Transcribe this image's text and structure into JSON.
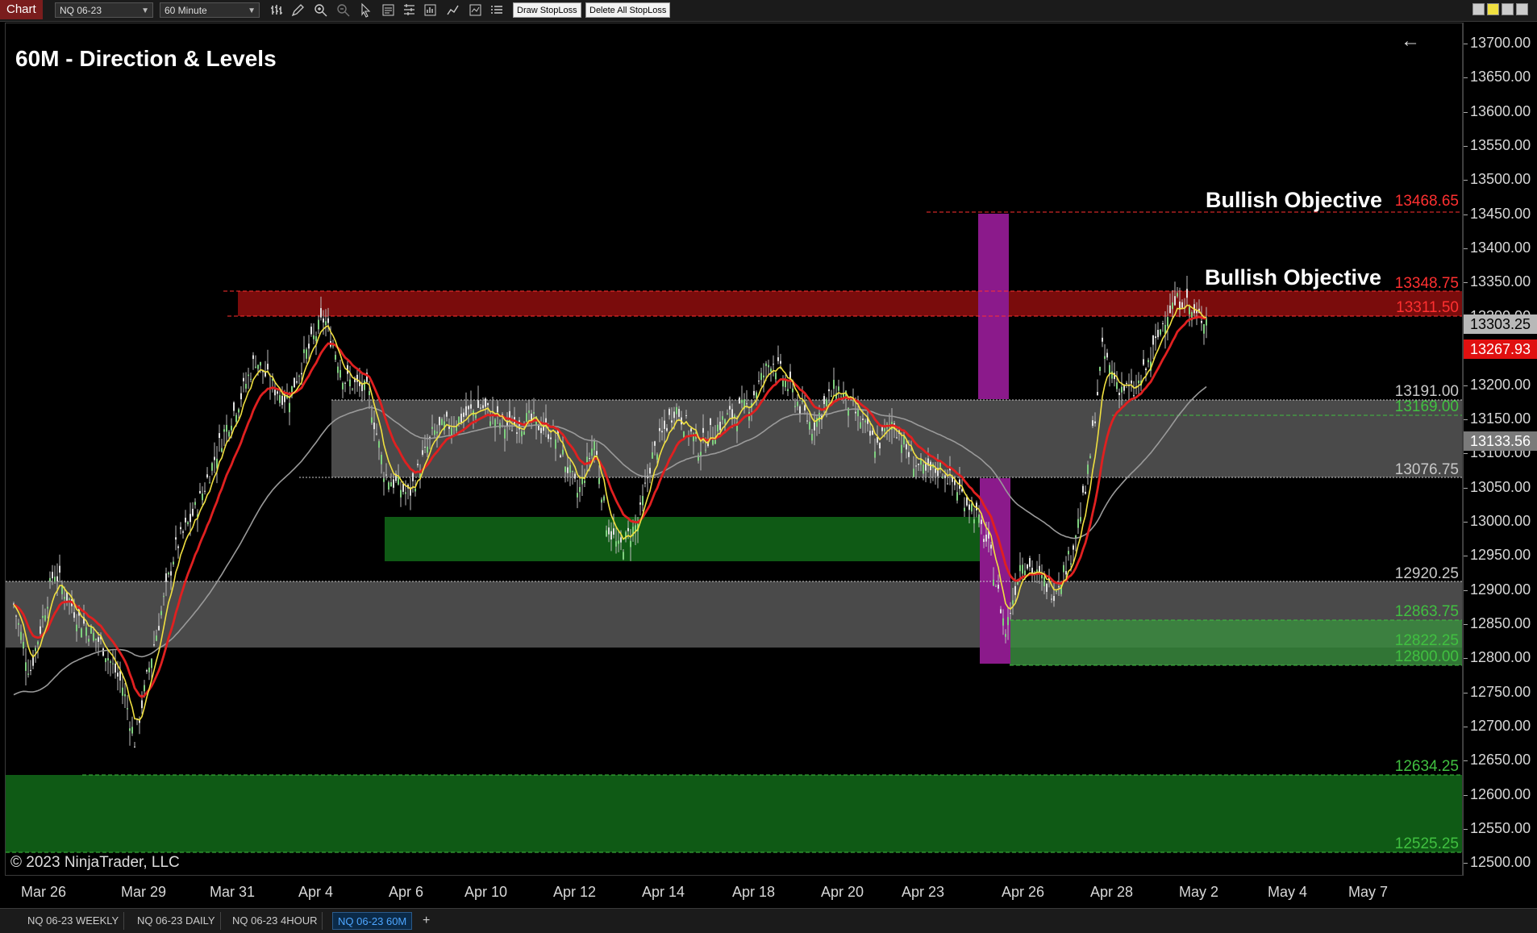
{
  "toolbar": {
    "app_label": "Chart",
    "instrument": "NQ 06-23",
    "interval": "60 Minute",
    "draw_stoploss": "Draw StopLoss",
    "delete_stoploss": "Delete All StopLoss"
  },
  "chart": {
    "title": "60M - Direction & Levels",
    "copyright": "© 2023 NinjaTrader, LLC",
    "objective_label_upper": "Bullish Objective",
    "objective_label_lower": "Bullish Objective"
  },
  "levels": {
    "l13468": "13468.65",
    "l13348": "13348.75",
    "l13311": "13311.50",
    "l13191": "13191.00",
    "l13169": "13169.00",
    "l13076": "13076.75",
    "l12920": "12920.25",
    "l12863": "12863.75",
    "l12822": "12822.25",
    "l12800": "12800.00",
    "l12634": "12634.25",
    "l12525": "12525.25"
  },
  "price_tags": {
    "last": "13303.25",
    "red_ma": "13267.93",
    "gray_ma": "13133.56"
  },
  "price_axis": [
    "13700.00",
    "13650.00",
    "13600.00",
    "13550.00",
    "13500.00",
    "13450.00",
    "13400.00",
    "13350.00",
    "13300.00",
    "13250.00",
    "13200.00",
    "13150.00",
    "13100.00",
    "13050.00",
    "13000.00",
    "12950.00",
    "12900.00",
    "12850.00",
    "12800.00",
    "12750.00",
    "12700.00",
    "12650.00",
    "12600.00",
    "12550.00",
    "12500.00"
  ],
  "date_axis": [
    "Mar 26",
    "Mar 29",
    "Mar 31",
    "Apr 4",
    "Apr 6",
    "Apr 10",
    "Apr 12",
    "Apr 14",
    "Apr 18",
    "Apr 20",
    "Apr 23",
    "Apr 26",
    "Apr 28",
    "May 2",
    "May 4",
    "May 7"
  ],
  "bottom_tabs": [
    "NQ 06-23 WEEKLY",
    "NQ 06-23 DAILY",
    "NQ 06-23 4HOUR",
    "NQ 06-23 60M"
  ],
  "colors": {
    "background": "#000000",
    "supply_zone": "#7a0c0c",
    "demand_zone": "#0f5a15",
    "light_demand_zone": "#3a8a3e",
    "neutral_zone": "#4a4a4a",
    "magenta_bar": "#8b1a8b",
    "fast_ma": "#f0e040",
    "slow_ma": "#e02020",
    "long_ma": "#9a9a9a",
    "red_level": "#ff3030",
    "green_level": "#40c040"
  },
  "chart_data": {
    "type": "line",
    "x": [
      "Mar 26",
      "Mar 29",
      "Mar 31",
      "Apr 4",
      "Apr 6",
      "Apr 10",
      "Apr 12",
      "Apr 14",
      "Apr 18",
      "Apr 20",
      "Apr 23",
      "Apr 26",
      "Apr 28",
      "May 2"
    ],
    "series": [
      {
        "values": [
          12880,
          12760,
          13180,
          13280,
          13020,
          13140,
          13060,
          13180,
          13230,
          13150,
          13050,
          12830,
          13200,
          13300
        ]
      },
      {
        "values": [
          12900,
          12800,
          13050,
          13260,
          13150,
          13120,
          13080,
          13150,
          13190,
          13160,
          13090,
          12970,
          13050,
          13268
        ]
      },
      {
        "values": [
          12650,
          12720,
          12880,
          13050,
          13070,
          13090,
          13100,
          13110,
          13120,
          13115,
          13100,
          13060,
          13080,
          13134
        ]
      }
    ],
    "ylim": [
      12500,
      13700
    ]
  }
}
